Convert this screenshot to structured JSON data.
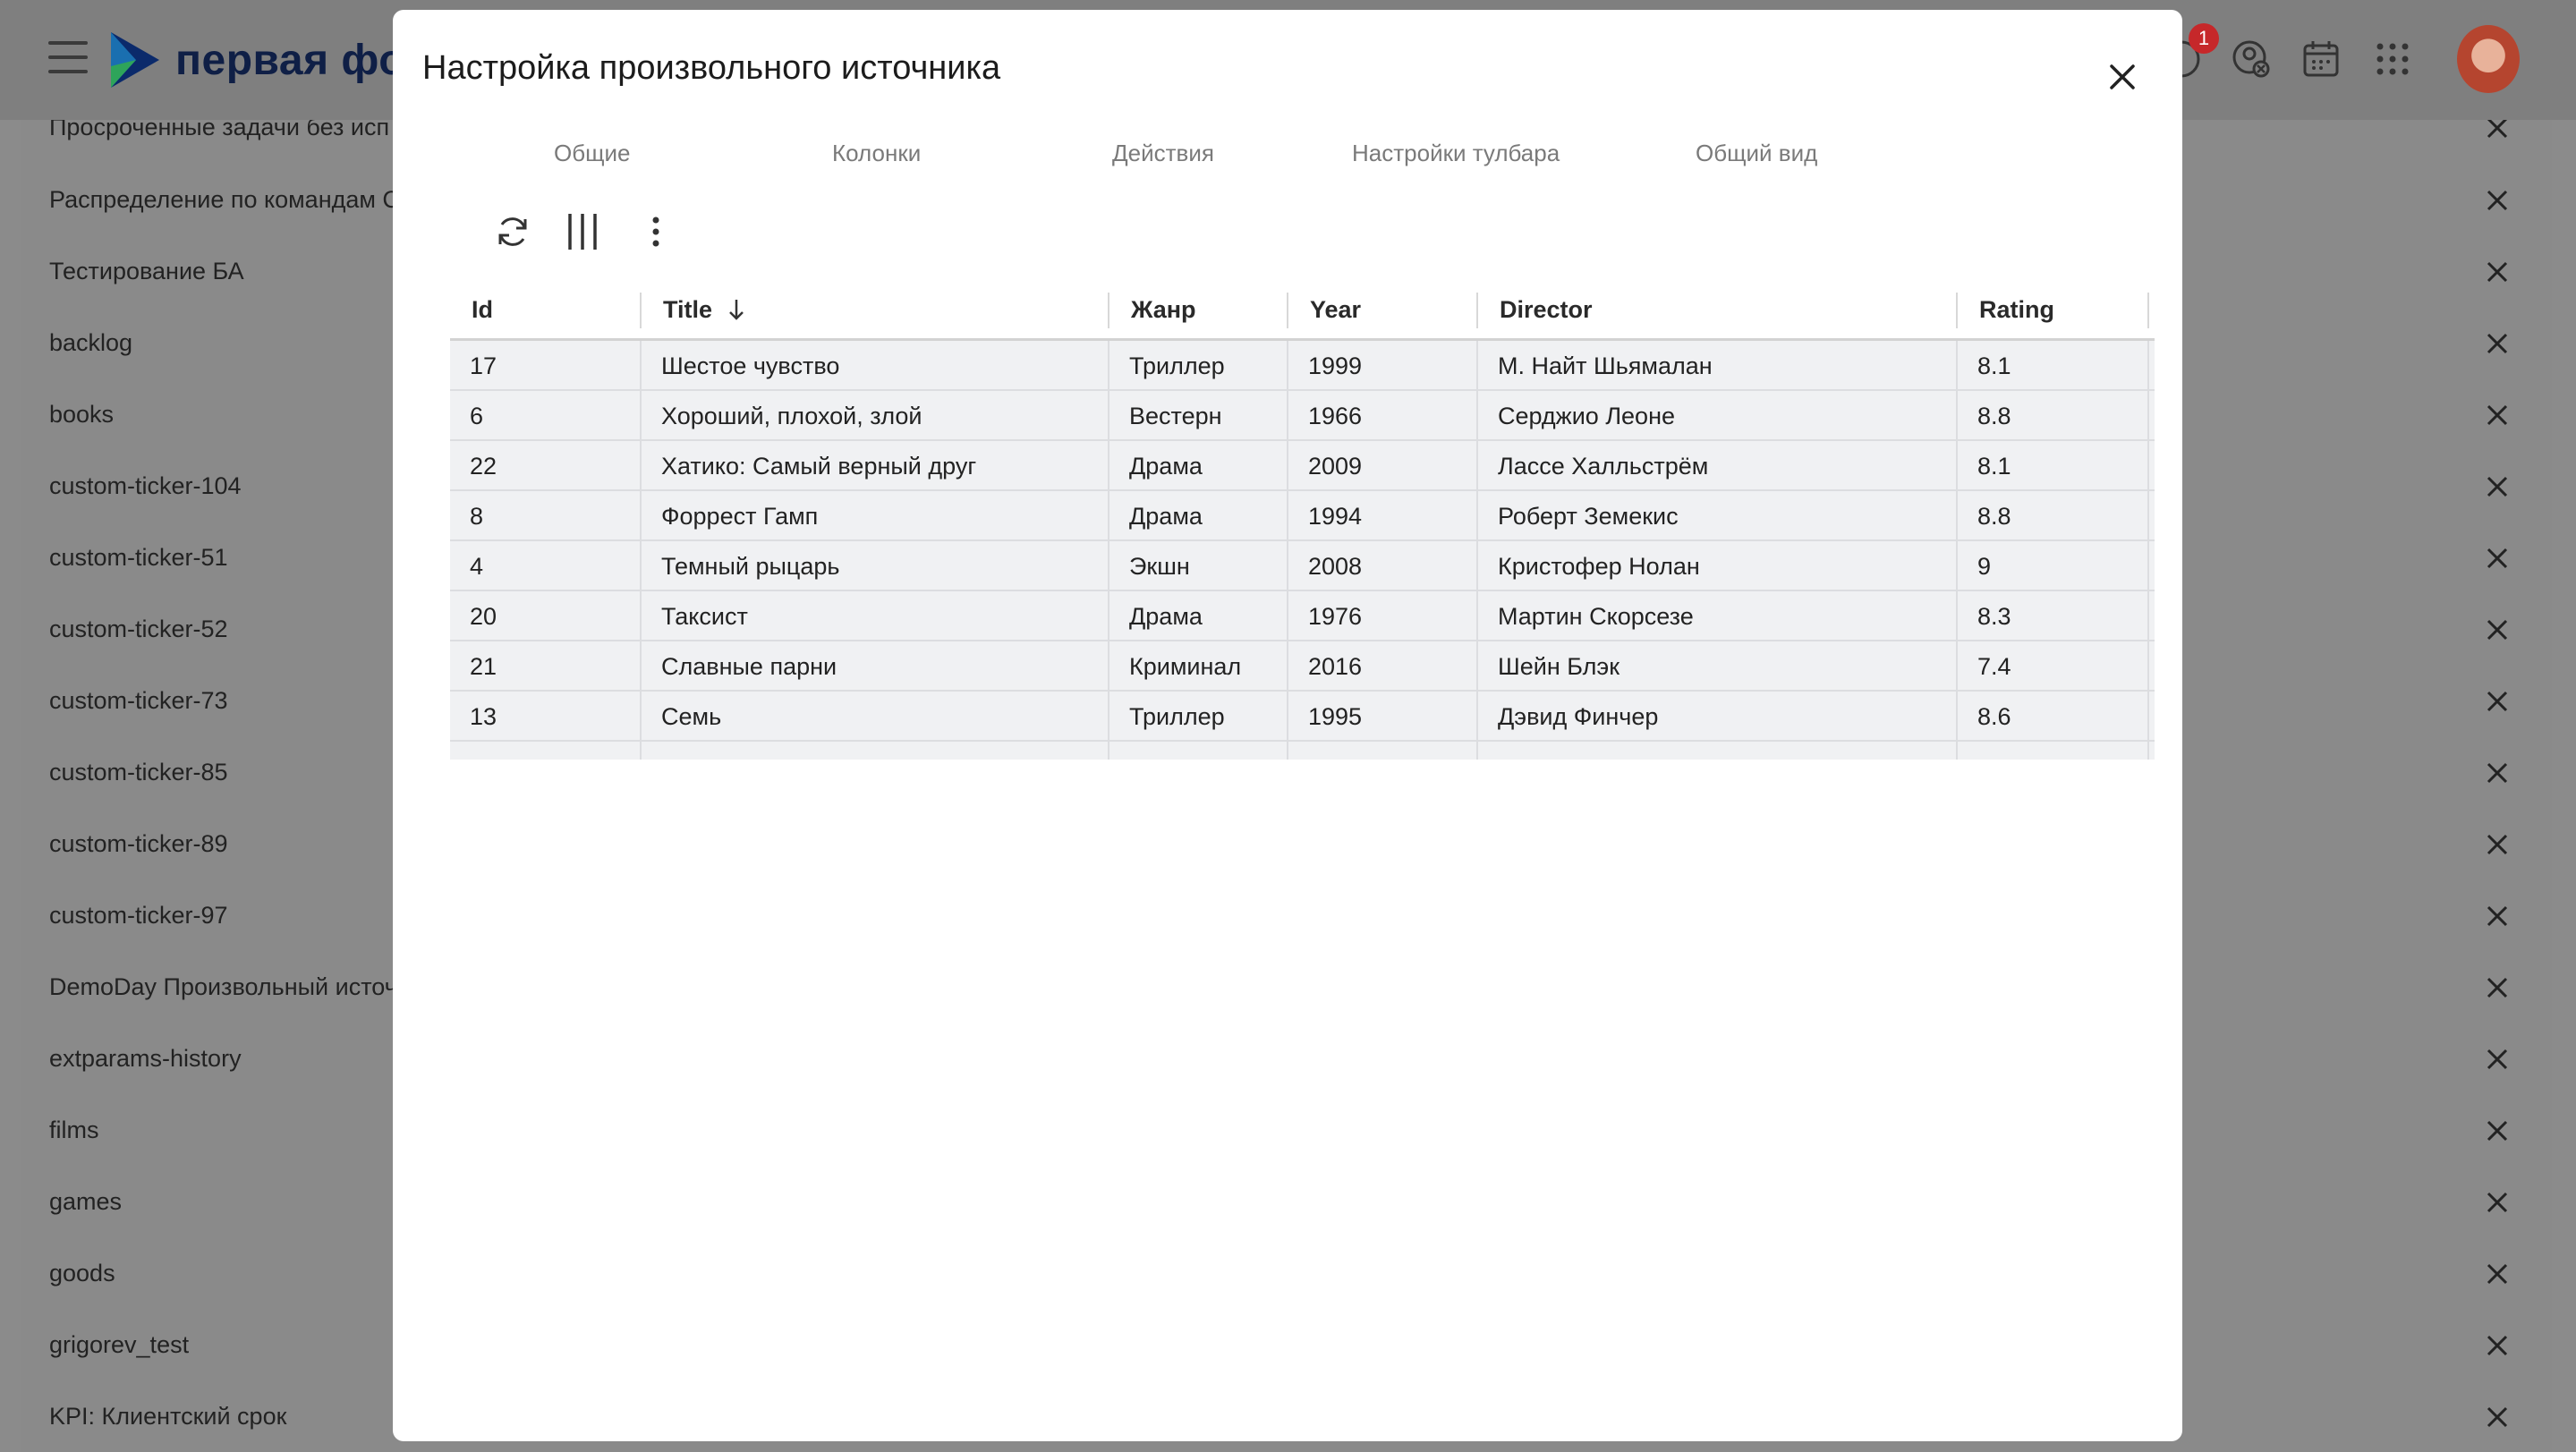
{
  "header": {
    "logo_text": "первая фор",
    "notification_count": "1"
  },
  "background_list": [
    "Просроченные задачи без исп",
    "Распределение по командам С",
    "Тестирование БА",
    "backlog",
    "books",
    "custom-ticker-104",
    "custom-ticker-51",
    "custom-ticker-52",
    "custom-ticker-73",
    "custom-ticker-85",
    "custom-ticker-89",
    "custom-ticker-97",
    "DemoDay Произвольный источ",
    "extparams-history",
    "films",
    "games",
    "goods",
    "grigorev_test",
    "KPI: Клиентский срок"
  ],
  "modal": {
    "title": "Настройка произвольного источника",
    "tabs": [
      "Общие",
      "Колонки",
      "Действия",
      "Настройки тулбара",
      "Общий вид"
    ]
  },
  "table": {
    "columns": [
      "Id",
      "Title",
      "Жанр",
      "Year",
      "Director",
      "Rating"
    ],
    "rows": [
      [
        "17",
        "Шестое чувство",
        "Триллер",
        "1999",
        "М. Найт Шьямалан",
        "8.1"
      ],
      [
        "6",
        "Хороший, плохой, злой",
        "Вестерн",
        "1966",
        "Серджио Леоне",
        "8.8"
      ],
      [
        "22",
        "Хатико: Самый верный друг",
        "Драма",
        "2009",
        "Лассе Халльстрём",
        "8.1"
      ],
      [
        "8",
        "Форрест Гамп",
        "Драма",
        "1994",
        "Роберт Земекис",
        "8.8"
      ],
      [
        "4",
        "Темный рыцарь",
        "Экшн",
        "2008",
        "Кристофер Нолан",
        "9"
      ],
      [
        "20",
        "Таксист",
        "Драма",
        "1976",
        "Мартин Скорсезе",
        "8.3"
      ],
      [
        "21",
        "Славные парни",
        "Криминал",
        "2016",
        "Шейн Блэк",
        "7.4"
      ],
      [
        "13",
        "Семь",
        "Триллер",
        "1995",
        "Дэвид Финчер",
        "8.6"
      ]
    ]
  }
}
